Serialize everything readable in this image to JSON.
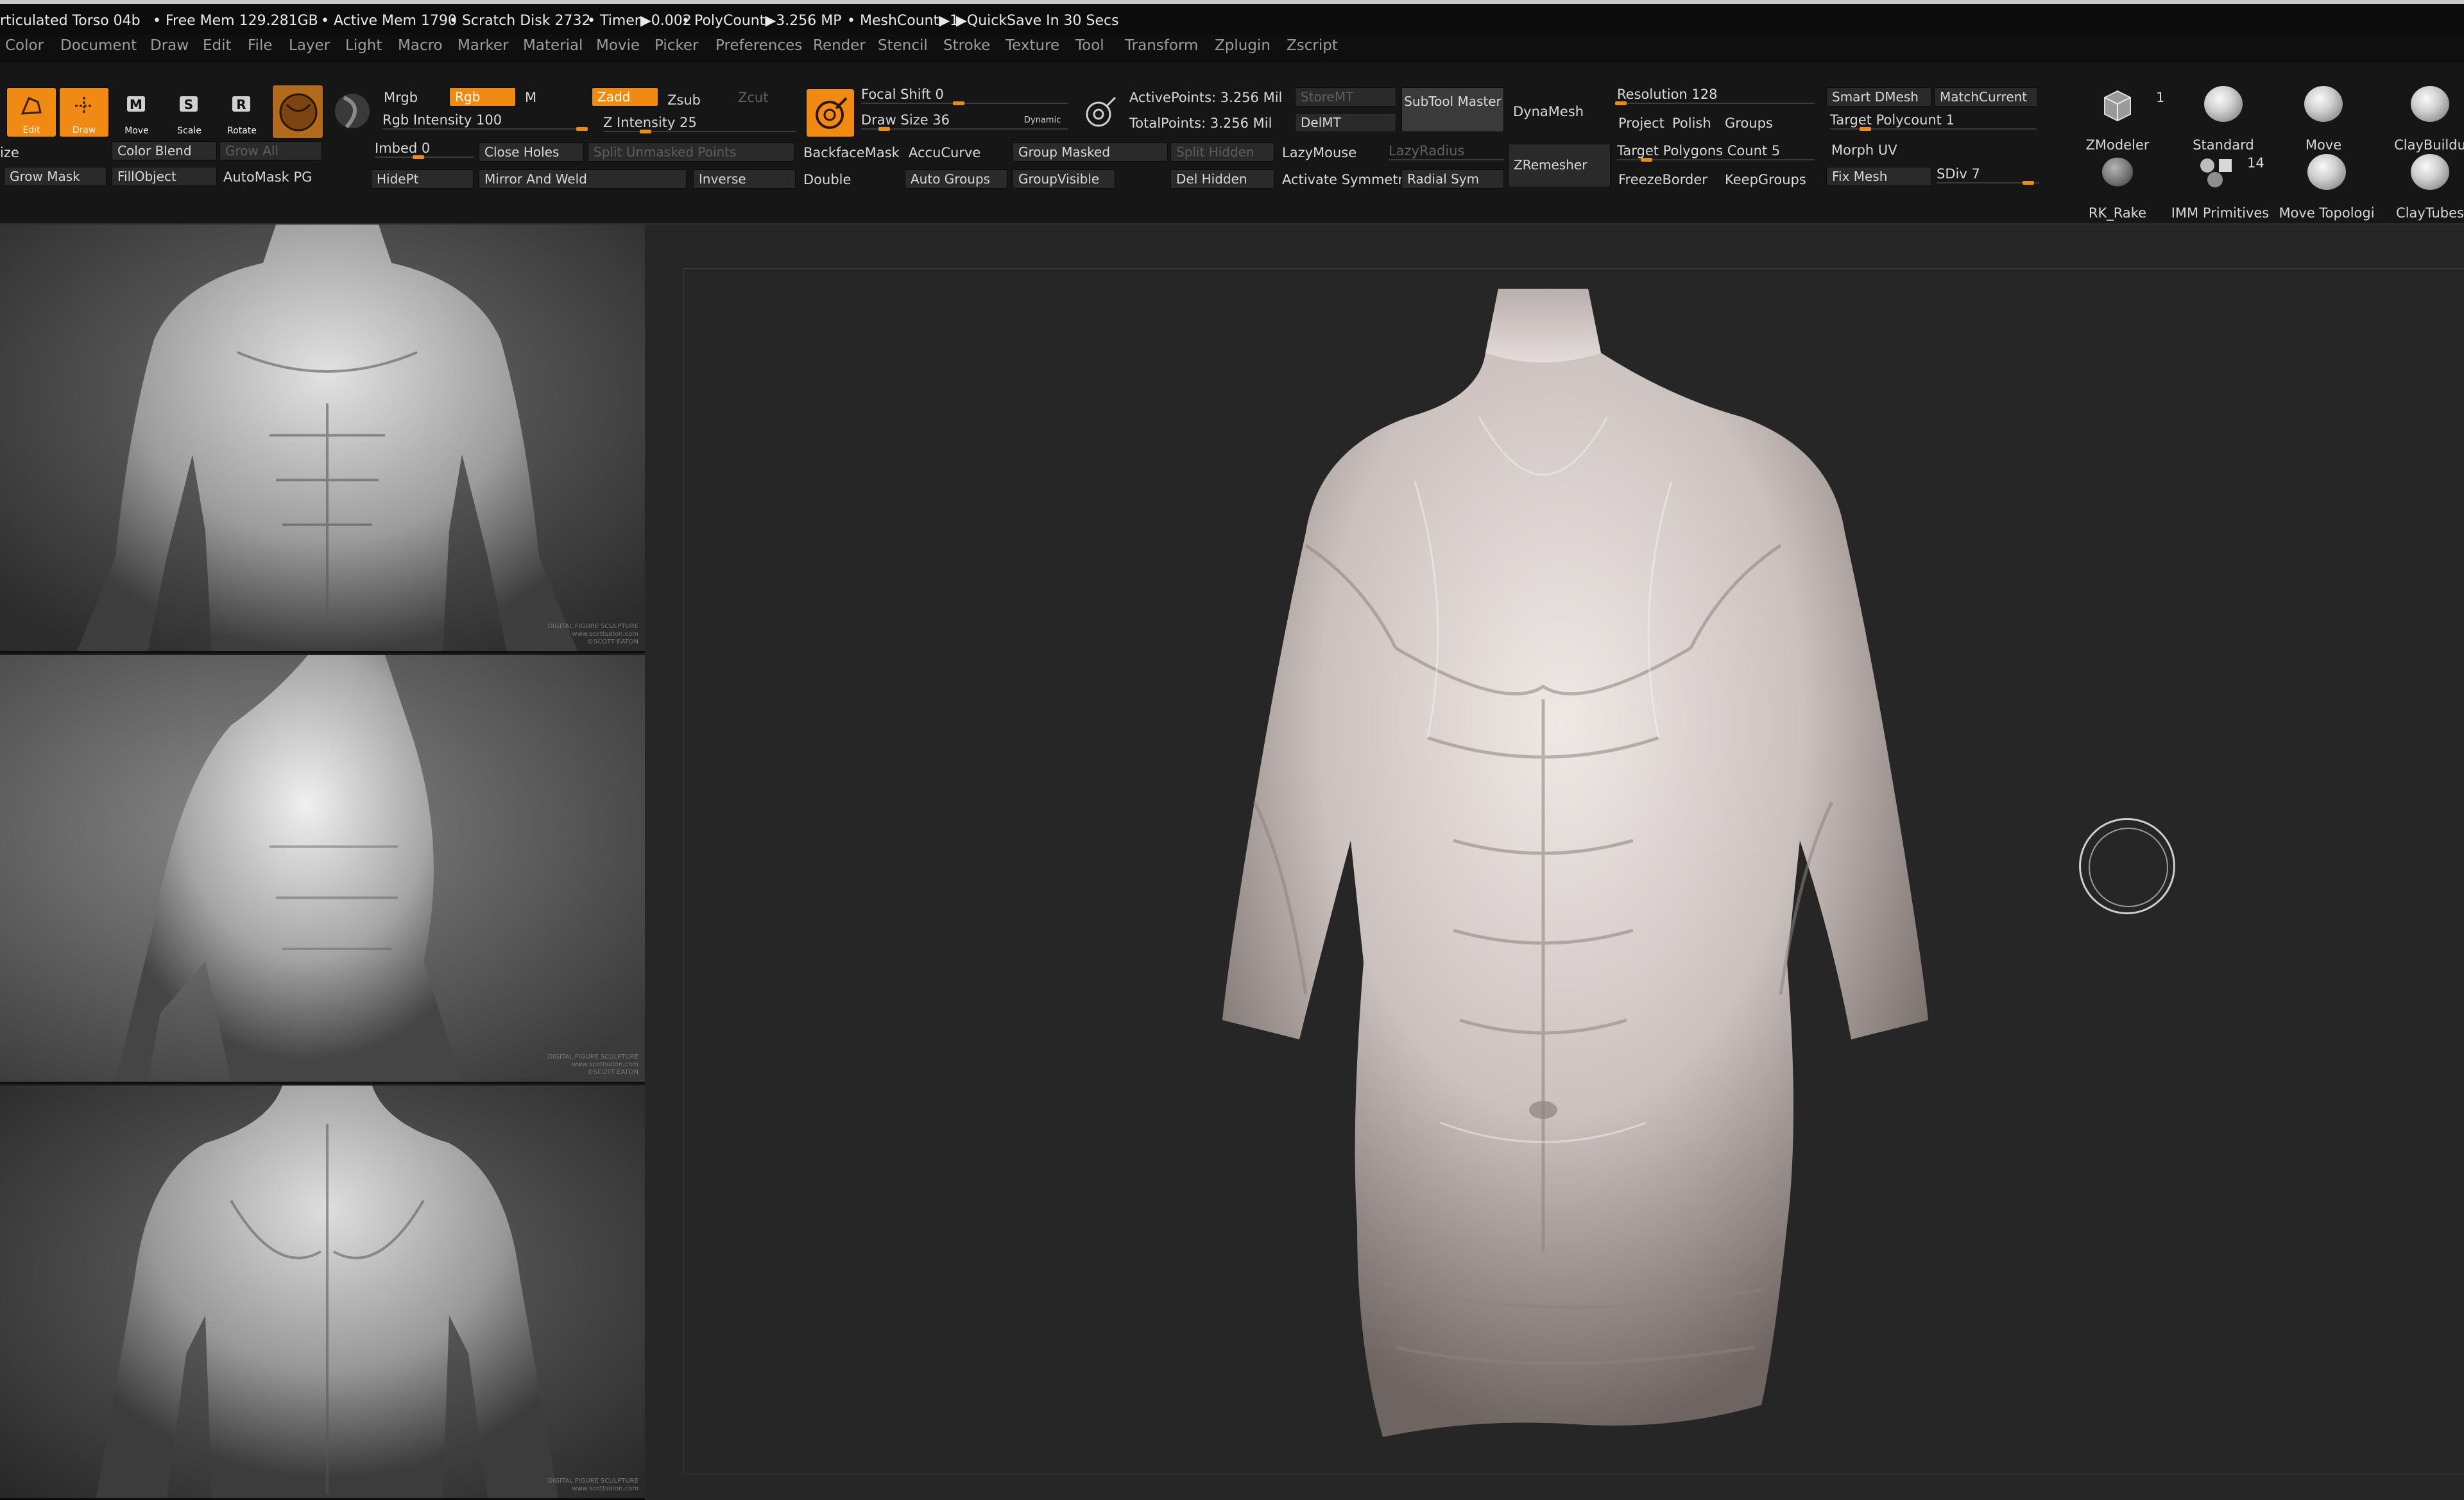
{
  "titlebar": {
    "title": "rticulated Torso 04b",
    "free_mem": "• Free Mem 129.281GB",
    "active_mem": "• Active Mem 1790",
    "scratch": "• Scratch Disk 2732",
    "timer": "• Timer▶0.002",
    "polycount": "• PolyCount▶3.256 MP",
    "meshcount": "• MeshCount▶1",
    "quicksave": "▶QuickSave In 30 Secs"
  },
  "menu": [
    "Color",
    "Document",
    "Draw",
    "Edit",
    "File",
    "Layer",
    "Light",
    "Macro",
    "Marker",
    "Material",
    "Movie",
    "Picker",
    "Preferences",
    "Render",
    "Stencil",
    "Stroke",
    "Texture",
    "Tool",
    "Transform",
    "Zplugin",
    "Zscript"
  ],
  "tools": {
    "edit": "Edit",
    "draw": "Draw",
    "move": "Move",
    "scale": "Scale",
    "rotate": "Rotate"
  },
  "shelf": {
    "ize": "ize",
    "color_blend": "Color Blend",
    "grow_all": "Grow All",
    "grow_mask": "Grow Mask",
    "fill_object": "FillObject",
    "automask_pg": "AutoMask PG",
    "mrgb": "Mrgb",
    "rgb": "Rgb",
    "m": "M",
    "zadd": "Zadd",
    "zsub": "Zsub",
    "zcut": "Zcut",
    "rgb_intensity": "Rgb Intensity 100",
    "z_intensity": "Z Intensity 25",
    "imbed": "Imbed 0",
    "close_holes": "Close Holes",
    "split_unmasked": "Split Unmasked Points",
    "hidept": "HidePt",
    "mirror_weld": "Mirror And Weld",
    "inverse": "Inverse",
    "focal_shift": "Focal Shift 0",
    "draw_size": "Draw Size 36",
    "dynamic": "Dynamic",
    "backface_mask": "BackfaceMask",
    "accucurve": "AccuCurve",
    "group_masked": "Group Masked",
    "split_hidden": "Split Hidden",
    "double": "Double",
    "auto_groups": "Auto Groups",
    "group_visible": "GroupVisible",
    "del_hidden": "Del Hidden",
    "active_points": "ActivePoints: 3.256 Mil",
    "total_points": "TotalPoints: 3.256 Mil",
    "storemt": "StoreMT",
    "delmt": "DelMT",
    "subtool_master": "SubTool Master",
    "dynamesh": "DynaMesh",
    "lazymouse": "LazyMouse",
    "lazyradius": "LazyRadius",
    "activate_symmetry": "Activate Symmetry",
    "radial_sym": "Radial Sym",
    "zremesher": "ZRemesher",
    "resolution": "Resolution 128",
    "project": "Project",
    "polish": "Polish",
    "groups": "Groups",
    "target_polygons": "Target Polygons Count 5",
    "freeze_border": "FreezeBorder",
    "keep_groups": "KeepGroups",
    "smart_dmesh": "Smart DMesh",
    "match_current": "MatchCurrent",
    "target_polycount": "Target Polycount 1",
    "morph_uv": "Morph UV",
    "fix_mesh": "Fix Mesh",
    "sdiv": "SDiv 7"
  },
  "brushes": [
    {
      "label": "ZModeler",
      "count": "1"
    },
    {
      "label": "Standard",
      "count": ""
    },
    {
      "label": "Move",
      "count": ""
    },
    {
      "label": "ClayBuildu",
      "count": ""
    },
    {
      "label": "RK_Rake",
      "count": ""
    },
    {
      "label": "IMM Primitives",
      "count": "14"
    },
    {
      "label": "Move Topologi",
      "count": ""
    },
    {
      "label": "ClayTubes",
      "count": ""
    }
  ],
  "sliders": {
    "rgb_intensity": 1.0,
    "z_intensity": 0.25,
    "focal_shift": 0.5,
    "draw_size": 0.14,
    "imbed": 0.5,
    "resolution": 0.05,
    "target_polygons": 0.18,
    "target_polycount": 0.2,
    "sdiv": 0.95
  },
  "refs": {
    "wm1": "DIGITAL FIGURE SCULPTURE",
    "wm2": "www.scottsaton.com",
    "wm3": "©SCOTT EATON"
  },
  "colors": {
    "accent": "#f08a12",
    "shelf": "#161616",
    "viewport": "#262626"
  }
}
